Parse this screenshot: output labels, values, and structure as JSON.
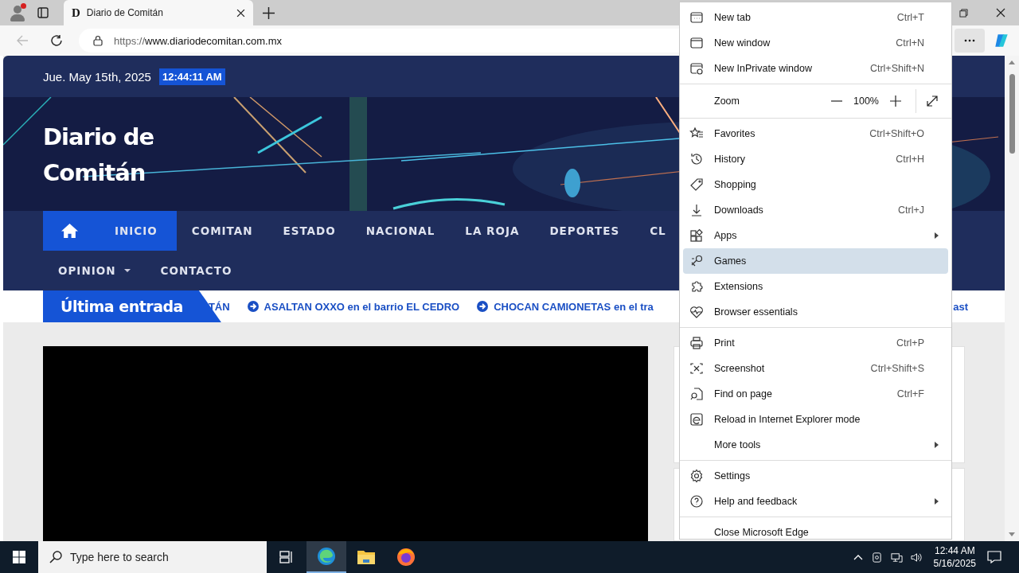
{
  "browser": {
    "tabs": [
      {
        "favicon": "D",
        "title": "Diario de Comitán",
        "selected": true
      }
    ],
    "address": {
      "scheme": "https://",
      "host": "www.diariodecomitan.com.mx"
    }
  },
  "site": {
    "date": "Jue. May 15th, 2025",
    "time": "12:44:11 AM",
    "title": "Diario de Comitán",
    "nav_rows": [
      [
        {
          "kind": "home",
          "selected": true
        },
        {
          "kind": "link",
          "label": "INICIO",
          "selected": true
        },
        {
          "kind": "link",
          "label": "COMITAN",
          "selected": false
        },
        {
          "kind": "link",
          "label": "ESTADO",
          "selected": false
        },
        {
          "kind": "link",
          "label": "NACIONAL",
          "selected": false
        },
        {
          "kind": "link",
          "label": "LA ROJA",
          "selected": false
        },
        {
          "kind": "link",
          "label": "DEPORTES",
          "selected": false
        },
        {
          "kind": "link",
          "label": "CL",
          "selected": false
        }
      ],
      [
        {
          "kind": "dropdown",
          "label": "OPINION",
          "selected": false
        },
        {
          "kind": "link",
          "label": "CONTACTO",
          "selected": false
        }
      ]
    ],
    "ticker": {
      "label": "Última entrada",
      "items": [
        {
          "text": "TÁN",
          "arrow": false
        },
        {
          "text": "ASALTAN OXXO en el barrio EL CEDRO",
          "arrow": true
        },
        {
          "text": "CHOCAN CAMIONETAS en el tra",
          "arrow": true
        },
        {
          "text": "ast",
          "arrow": false
        }
      ]
    }
  },
  "menu": {
    "groups": [
      [
        {
          "kind": "item",
          "label": "New tab",
          "shortcut": "Ctrl+T",
          "selected": false
        },
        {
          "kind": "item",
          "label": "New window",
          "shortcut": "Ctrl+N",
          "selected": false
        },
        {
          "kind": "item",
          "label": "New InPrivate window",
          "shortcut": "Ctrl+Shift+N",
          "selected": false
        }
      ],
      [
        {
          "kind": "zoom",
          "label": "Zoom",
          "value": "100%"
        }
      ],
      [
        {
          "kind": "item",
          "label": "Favorites",
          "shortcut": "Ctrl+Shift+O",
          "selected": false
        },
        {
          "kind": "item",
          "label": "History",
          "shortcut": "Ctrl+H",
          "selected": false
        },
        {
          "kind": "item",
          "label": "Shopping",
          "selected": false
        },
        {
          "kind": "item",
          "label": "Downloads",
          "shortcut": "Ctrl+J",
          "selected": false
        },
        {
          "kind": "submenu",
          "label": "Apps",
          "selected": false
        },
        {
          "kind": "item",
          "label": "Games",
          "selected": true
        },
        {
          "kind": "item",
          "label": "Extensions",
          "selected": false
        },
        {
          "kind": "item",
          "label": "Browser essentials",
          "selected": false
        }
      ],
      [
        {
          "kind": "item",
          "label": "Print",
          "shortcut": "Ctrl+P",
          "selected": false
        },
        {
          "kind": "item",
          "label": "Screenshot",
          "shortcut": "Ctrl+Shift+S",
          "selected": false
        },
        {
          "kind": "item",
          "label": "Find on page",
          "shortcut": "Ctrl+F",
          "selected": false
        },
        {
          "kind": "item",
          "label": "Reload in Internet Explorer mode",
          "selected": false
        },
        {
          "kind": "submenu",
          "label": "More tools",
          "selected": false
        }
      ],
      [
        {
          "kind": "item",
          "label": "Settings",
          "selected": false
        },
        {
          "kind": "submenu",
          "label": "Help and feedback",
          "selected": false
        }
      ],
      [
        {
          "kind": "item",
          "label": "Close Microsoft Edge",
          "selected": false
        }
      ]
    ]
  },
  "taskbar": {
    "search_placeholder": "Type here to search",
    "apps": [
      {
        "selected": false
      },
      {
        "selected": true
      },
      {
        "selected": false
      },
      {
        "selected": false
      }
    ],
    "time": "12:44 AM",
    "date": "5/16/2025"
  }
}
